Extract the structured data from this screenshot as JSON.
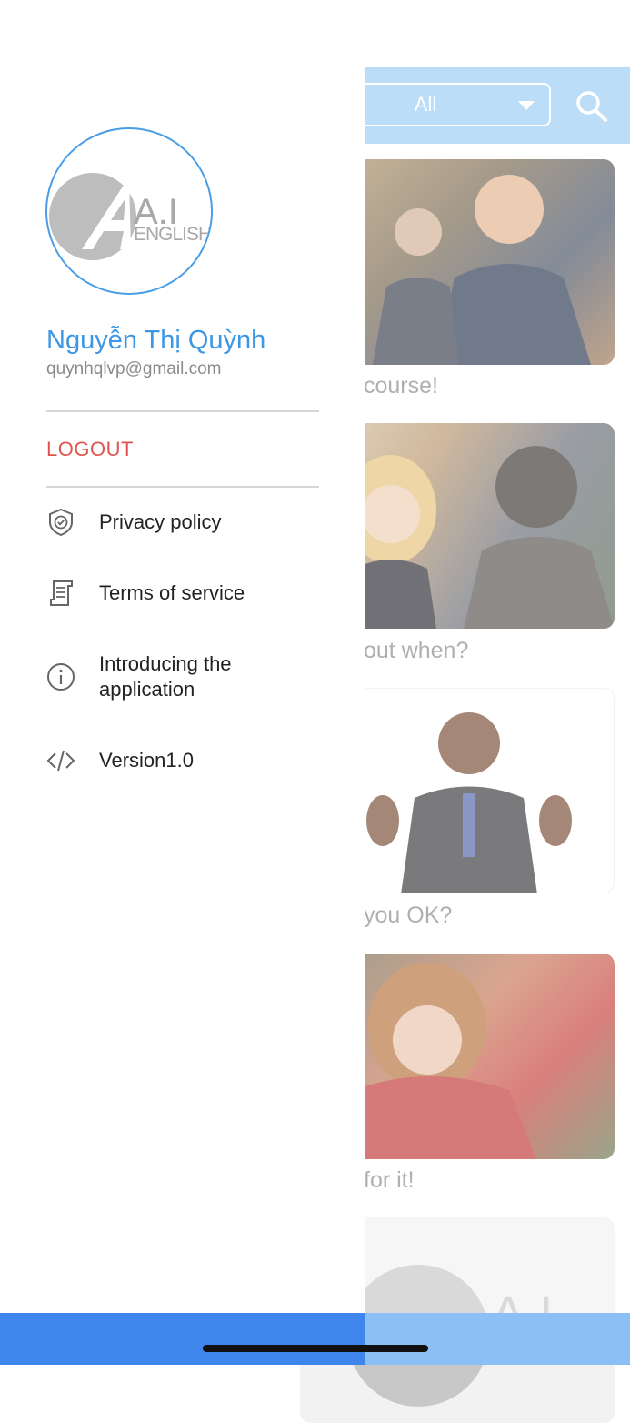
{
  "background_app": {
    "filter": {
      "selected": "All"
    },
    "icons": {
      "search": "search-icon",
      "dropdown": "chevron-down-icon"
    },
    "cards": [
      {
        "caption": "course!"
      },
      {
        "caption": "out when?"
      },
      {
        "caption": "you OK?"
      },
      {
        "caption": "for it!"
      },
      {
        "caption": "A.I"
      }
    ]
  },
  "drawer": {
    "logo": {
      "title": "A.I",
      "subtitle": "ENGLISH"
    },
    "user": {
      "name": "Nguyễn Thị Quỳnh",
      "email": "quynhqlvp@gmail.com"
    },
    "logout_label": "LOGOUT",
    "menu": [
      {
        "label": "Privacy policy",
        "icon": "shield-check-icon"
      },
      {
        "label": "Terms of service",
        "icon": "document-icon"
      },
      {
        "label": "Introducing the application",
        "icon": "info-icon"
      },
      {
        "label": "Version1.0",
        "icon": "code-icon"
      }
    ]
  },
  "colors": {
    "accent": "#3e97e4",
    "logout": "#e0554f",
    "topbar": "#9bcdf3",
    "drawer_bottom": "#3f86ec"
  }
}
